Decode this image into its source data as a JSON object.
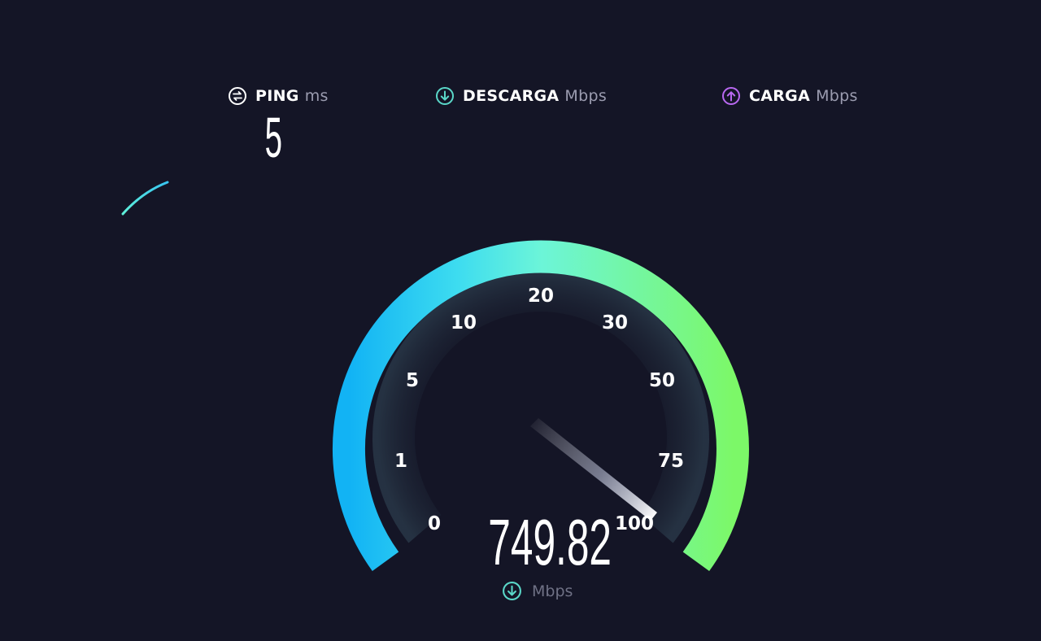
{
  "metrics": {
    "ping": {
      "label": "PING",
      "unit": "ms",
      "icon": "ping-icon",
      "color": "#ffffff"
    },
    "download": {
      "label": "DESCARGA",
      "unit": "Mbps",
      "icon": "download-icon",
      "color": "#5ad7c8"
    },
    "upload": {
      "label": "CARGA",
      "unit": "Mbps",
      "icon": "upload-icon",
      "color": "#b868f0"
    }
  },
  "ping_value": "5",
  "gauge": {
    "ticks": [
      "0",
      "1",
      "5",
      "10",
      "20",
      "30",
      "50",
      "75",
      "100"
    ],
    "arc_colors": [
      "#12b6f5",
      "#5ff0d9",
      "#78f76a"
    ],
    "needle_position": "100"
  },
  "speed": {
    "value": "749.82",
    "unit": "Mbps"
  }
}
